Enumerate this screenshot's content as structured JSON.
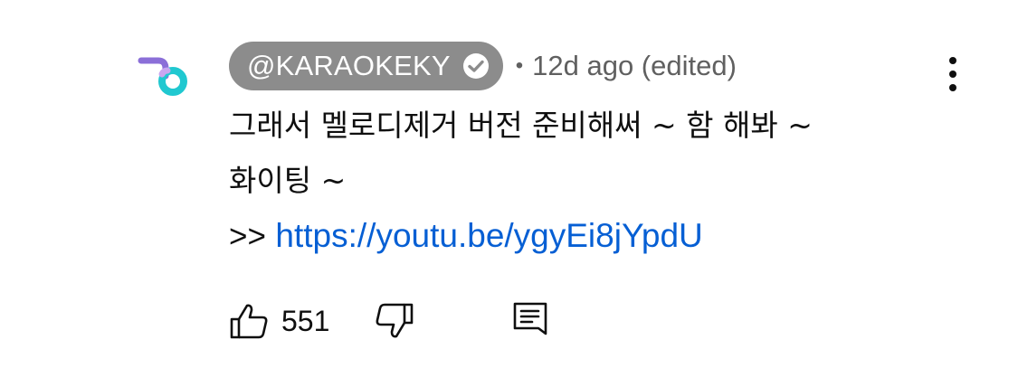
{
  "comment": {
    "author": "@KARAOKEKY",
    "meta_dot": "•",
    "time": "12d ago (edited)",
    "lines": [
      "그래서 멜로디제거 버전 준비해써 ~ 함 해봐 ~",
      "화이팅 ~"
    ],
    "link_prefix": ">>",
    "link_text": "https://youtu.be/ygyEi8jYpdU",
    "like_count": "551"
  },
  "icons": {
    "avatar": "channel-logo",
    "verified": "verified-check-icon",
    "more": "more-vertical-icon",
    "like": "thumbs-up-icon",
    "dislike": "thumbs-down-icon",
    "reply": "reply-comment-icon"
  },
  "colors": {
    "author_pill": "#8c8c8c",
    "link": "#065fd4",
    "meta_text": "#606060",
    "logo_purple": "#8b6fd8",
    "logo_cyan": "#20c8d0"
  }
}
